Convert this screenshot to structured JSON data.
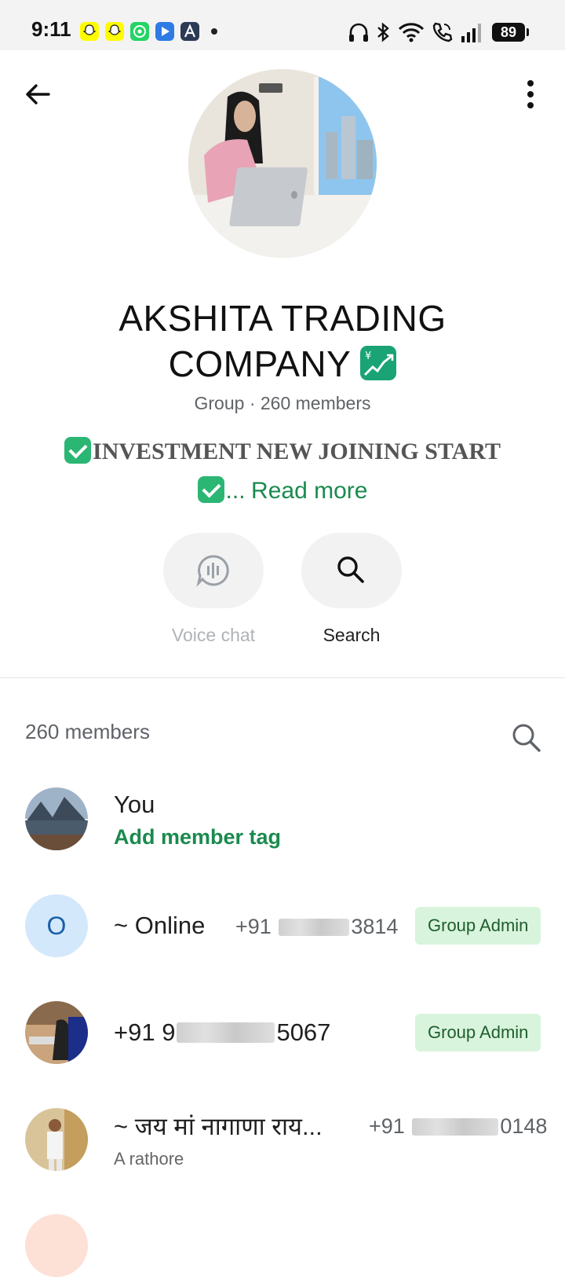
{
  "status_bar": {
    "time": "9:11",
    "battery": "89",
    "apps": [
      "snapchat-icon",
      "snapchat-icon",
      "whatsapp-icon",
      "play-icon",
      "a-icon"
    ]
  },
  "group": {
    "name_line1": "AKSHITA TRADING",
    "name_line2": "COMPANY",
    "meta": "Group · 260 members",
    "description": "INVESTMENT NEW JOINING START",
    "ellipsis": "...",
    "read_more": "Read more"
  },
  "actions": {
    "voice_chat": "Voice chat",
    "search": "Search"
  },
  "members": {
    "header": "260 members",
    "rows": [
      {
        "name": "You",
        "sub": "Add member tag"
      },
      {
        "name": "~ Online",
        "phone_prefix": "+91",
        "phone_suffix": "3814",
        "badge": "Group Admin",
        "initial": "O"
      },
      {
        "name_prefix": "+91 9",
        "name_suffix": "5067",
        "badge": "Group Admin"
      },
      {
        "name": "~ जय मां नागाणा राय...",
        "sub": "A rathore",
        "phone_prefix": "+91",
        "phone_suffix": "0148"
      }
    ]
  },
  "colors": {
    "accent_green": "#1a8a4e",
    "badge_bg": "#d9f4dc",
    "badge_text": "#1f5e2e"
  }
}
